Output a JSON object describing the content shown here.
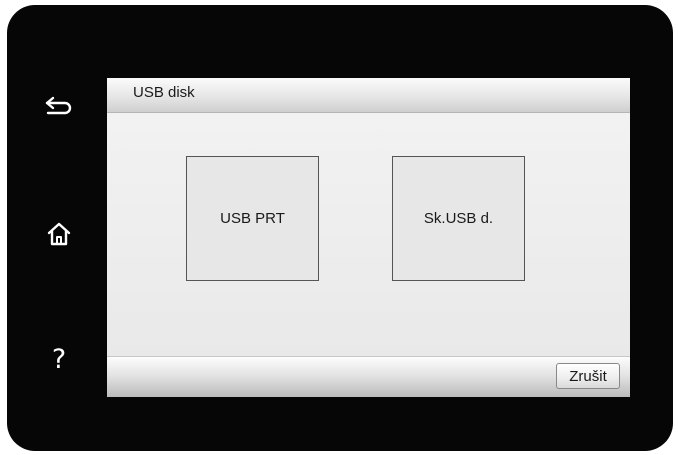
{
  "side_keys": [
    {
      "icon": "back-arrow-icon"
    },
    {
      "icon": "home-icon"
    },
    {
      "icon": "help-icon",
      "glyph": "?"
    }
  ],
  "screen": {
    "title": "USB disk",
    "tiles": [
      {
        "label": "USB PRT"
      },
      {
        "label": "Sk.USB d."
      }
    ],
    "cancel_label": "Zrušit"
  }
}
